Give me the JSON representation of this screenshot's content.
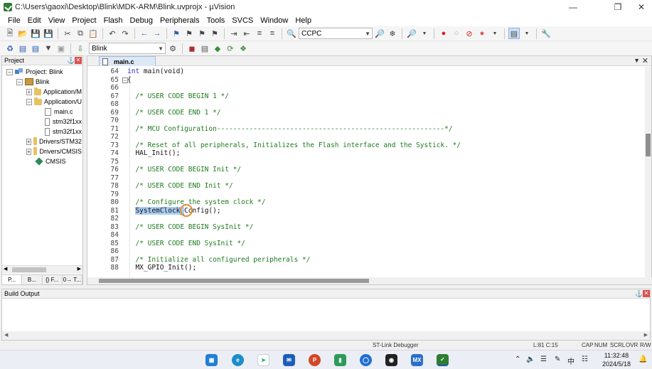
{
  "window": {
    "title": "C:\\Users\\gaoxi\\Desktop\\Blink\\MDK-ARM\\Blink.uvprojx - µVision"
  },
  "menu": [
    "File",
    "Edit",
    "View",
    "Project",
    "Flash",
    "Debug",
    "Peripherals",
    "Tools",
    "SVCS",
    "Window",
    "Help"
  ],
  "toolbar": {
    "find_combo": "CCPC",
    "target_combo": "Blink"
  },
  "project": {
    "panel_title": "Project",
    "root": "Project: Blink",
    "target": "Blink",
    "groups": [
      "Application/M",
      "Application/U",
      "Drivers/STM32",
      "Drivers/CMSIS"
    ],
    "files": [
      "main.c",
      "stm32f1xx",
      "stm32f1xx"
    ],
    "component": "CMSIS",
    "tabs": [
      "P...",
      "B...",
      "{} F...",
      "0→ T..."
    ]
  },
  "editor": {
    "tab": "main.c",
    "lines": [
      {
        "n": "64",
        "t": "int main(void)"
      },
      {
        "n": "65",
        "t": "{"
      },
      {
        "n": "66",
        "t": ""
      },
      {
        "n": "67",
        "t": "  /* USER CODE BEGIN 1 */"
      },
      {
        "n": "68",
        "t": ""
      },
      {
        "n": "69",
        "t": "  /* USER CODE END 1 */"
      },
      {
        "n": "70",
        "t": ""
      },
      {
        "n": "71",
        "t": "  /* MCU Configuration--------------------------------------------------------*/"
      },
      {
        "n": "72",
        "t": ""
      },
      {
        "n": "73",
        "t": "  /* Reset of all peripherals, Initializes the Flash interface and the Systick. */"
      },
      {
        "n": "74",
        "t": "  HAL_Init();"
      },
      {
        "n": "75",
        "t": ""
      },
      {
        "n": "76",
        "t": "  /* USER CODE BEGIN Init */"
      },
      {
        "n": "77",
        "t": ""
      },
      {
        "n": "78",
        "t": "  /* USER CODE END Init */"
      },
      {
        "n": "79",
        "t": ""
      },
      {
        "n": "80",
        "t": "  /* Configure the system clock */"
      },
      {
        "n": "81",
        "t": "  SystemClock_Config();"
      },
      {
        "n": "82",
        "t": ""
      },
      {
        "n": "83",
        "t": "  /* USER CODE BEGIN SysInit */"
      },
      {
        "n": "84",
        "t": ""
      },
      {
        "n": "85",
        "t": "  /* USER CODE END SysInit */"
      },
      {
        "n": "86",
        "t": ""
      },
      {
        "n": "87",
        "t": "  /* Initialize all configured peripherals */"
      },
      {
        "n": "88",
        "t": "  MX_GPIO_Init();"
      }
    ],
    "highlight": "SystemClock_",
    "highlight_rest": "Config();"
  },
  "build": {
    "title": "Build Output"
  },
  "status": {
    "debugger": "ST-Link Debugger",
    "position": "L:81 C:15",
    "caps": "CAP",
    "num": "NUM",
    "scrl": "SCRL",
    "ovr": "OVR",
    "rw": "R/W"
  },
  "taskbar": {
    "time": "11:32:48",
    "date": "2024/5/18",
    "ime": "中"
  }
}
